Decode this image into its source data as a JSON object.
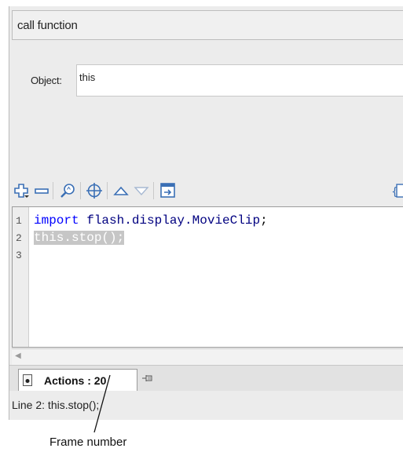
{
  "header": {
    "selected_function": "call function"
  },
  "properties": {
    "object_label": "Object:",
    "object_value": "this"
  },
  "toolbar": {
    "icons": [
      "add-statement-icon",
      "delete-statement-icon",
      "find-icon",
      "insert-target-path-icon",
      "move-up-icon",
      "move-down-icon",
      "script-assist-icon",
      "code-hint-icon"
    ]
  },
  "editor": {
    "line_numbers": [
      "1",
      "2",
      "3"
    ],
    "lines": [
      {
        "keyword": "import",
        "package": " flash.display.",
        "class": "MovieClip",
        "punc": ";"
      },
      {
        "highlighted": "this.stop();"
      }
    ]
  },
  "tab": {
    "label": "Actions : 20"
  },
  "status": {
    "text": "Line 2: this.stop();"
  },
  "callout": {
    "label": "Frame number"
  },
  "colors": {
    "keyword": "#0000ff",
    "class": "#000080",
    "highlight": "#c6c6c6"
  }
}
